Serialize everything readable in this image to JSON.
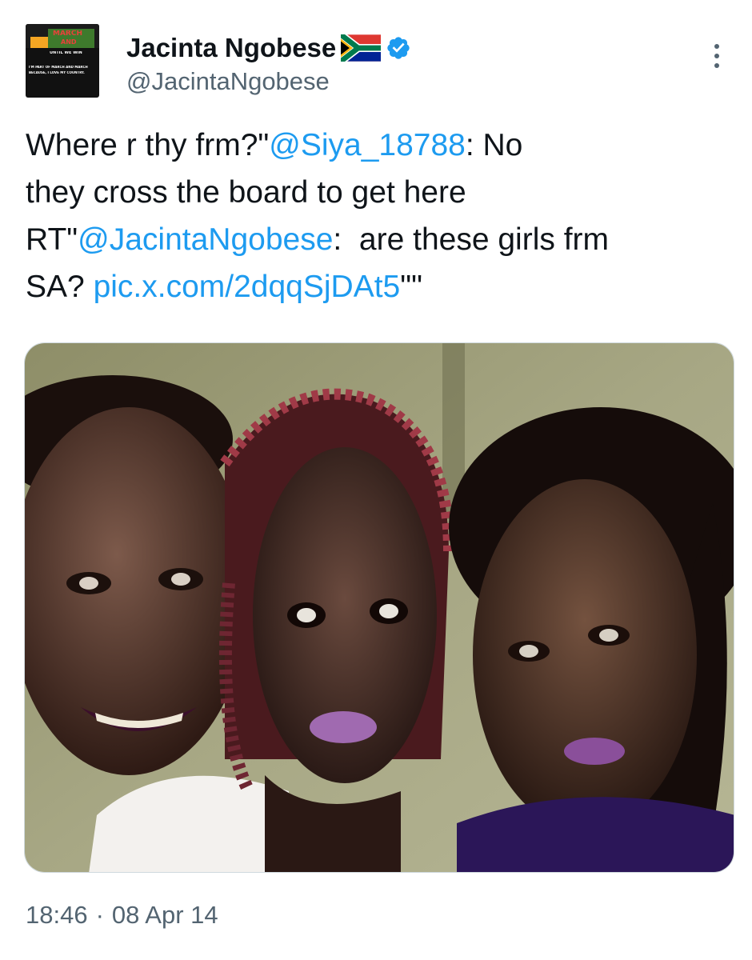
{
  "author": {
    "display_name": "Jacinta Ngobese",
    "handle": "@JacintaNgobese",
    "avatar": {
      "top_text": "MARCH",
      "mid_text": "AND",
      "sub_text": "UNTIL WE WIN",
      "caption_1": "I'M PART OF MARCH AND MARCH",
      "caption_2": "BECAUSE, I LOVE MY COUNTRY."
    },
    "flag_icon": "south-africa-flag-emoji",
    "verified_icon": "verified-badge-icon",
    "verified_color": "#1d9bf0"
  },
  "menu_icon": "more-options-icon",
  "tweet": {
    "lines": [
      [
        {
          "t": "Where r thy frm?\"",
          "link": false
        },
        {
          "t": "@Siya_18788",
          "link": true
        },
        {
          "t": ": No",
          "link": false
        }
      ],
      [
        {
          "t": "they cross the board to get here",
          "link": false
        }
      ],
      [
        {
          "t": "RT\"",
          "link": false
        },
        {
          "t": "@JacintaNgobese",
          "link": true
        },
        {
          "t": ":  are these girls frm",
          "link": false
        }
      ],
      [
        {
          "t": "SA? ",
          "link": false
        },
        {
          "t": "pic.x.com/2dqqSjDAt5",
          "link": true
        },
        {
          "t": "\"\"",
          "link": false
        }
      ]
    ],
    "link_color": "#1d9bf0",
    "text_color": "#0f1419"
  },
  "footer": {
    "time": "18:46",
    "separator": "·",
    "date": "08 Apr 14",
    "meta_color": "#536471"
  }
}
